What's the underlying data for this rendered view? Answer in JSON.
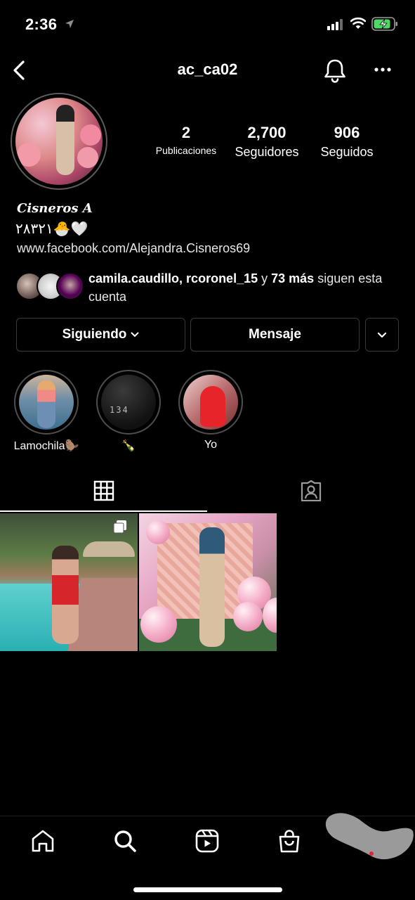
{
  "status_bar": {
    "time": "2:36"
  },
  "header": {
    "username": "ac_ca02"
  },
  "stats": {
    "posts": {
      "value": "2",
      "label": "Publicaciones"
    },
    "followers": {
      "value": "2,700",
      "label": "Seguidores"
    },
    "following": {
      "value": "906",
      "label": "Seguidos"
    }
  },
  "bio": {
    "display_name": "Cisneros A",
    "line": "٢٨٣٢١🐣🤍",
    "link": "www.facebook.com/Alejandra.Cisneros69"
  },
  "mutual": {
    "names": "camila.caudillo, rcoronel_15",
    "connector": " y ",
    "more": "73 más",
    "suffix": " siguen esta cuenta"
  },
  "actions": {
    "following_label": "Siguiendo",
    "message_label": "Mensaje"
  },
  "highlights": [
    {
      "label": "Lamochila🦫"
    },
    {
      "label": "🍾",
      "cover_text": "134"
    },
    {
      "label": "Yo"
    }
  ],
  "icons": {
    "back": "chevron-left-icon",
    "bell": "bell-icon",
    "more": "more-horizontal-icon",
    "grid": "grid-icon",
    "tagged": "tagged-icon",
    "nav": [
      "home-icon",
      "search-icon",
      "reels-icon",
      "shop-icon",
      "profile-icon"
    ]
  },
  "colors": {
    "background": "#000000",
    "text": "#ffffff",
    "border": "#3a3a3a"
  }
}
